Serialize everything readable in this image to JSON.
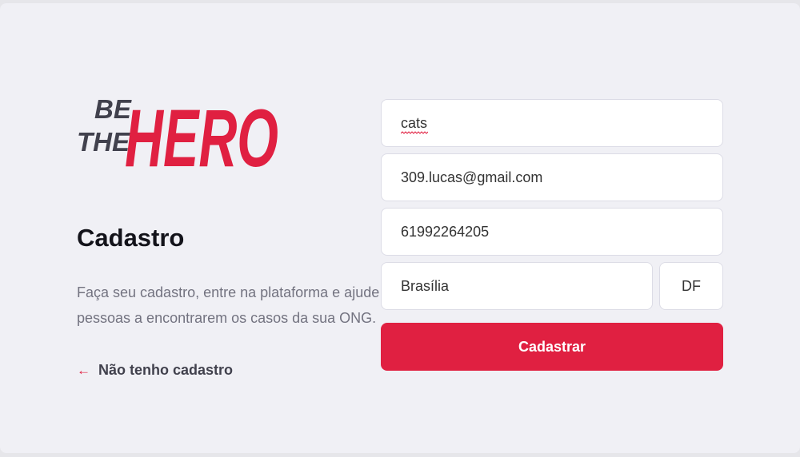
{
  "brand": {
    "line1": "BE",
    "line2": "THE",
    "line3": "HERO",
    "accent": "#e02041",
    "dark": "#41414d"
  },
  "register": {
    "title": "Cadastro",
    "description": "Faça seu cadastro, entre na plataforma e ajude pessoas a encontrarem os casos da sua ONG.",
    "back_link": "Não tenho cadastro",
    "back_icon": "arrow-left-icon"
  },
  "form": {
    "name": "cats",
    "email": "309.lucas@gmail.com",
    "whatsapp": "61992264205",
    "city": "Brasília",
    "uf": "DF",
    "submit_label": "Cadastrar"
  }
}
